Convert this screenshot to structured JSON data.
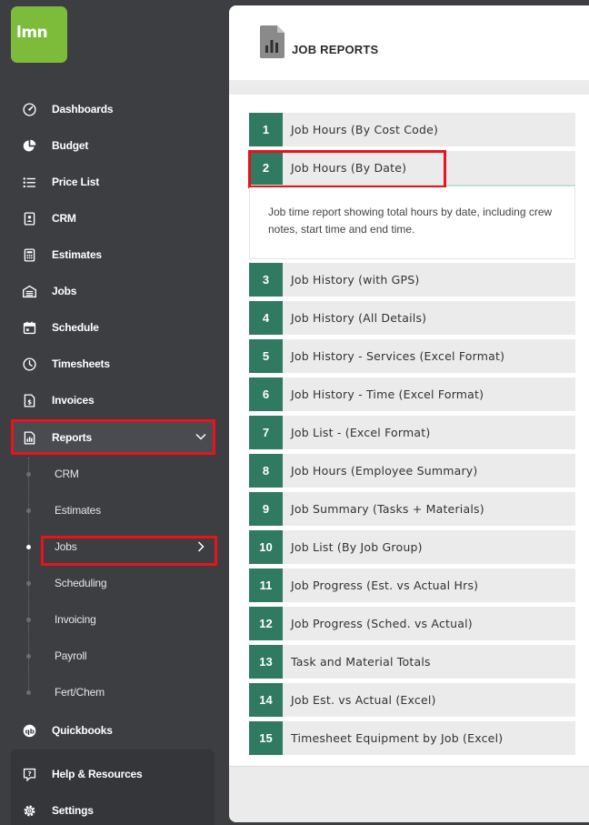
{
  "brand": {
    "logo_text": "lmn",
    "logo_color": "#7dbb3a"
  },
  "sidebar": {
    "items": [
      {
        "label": "Dashboards",
        "icon": "gauge-icon"
      },
      {
        "label": "Budget",
        "icon": "pie-chart-icon"
      },
      {
        "label": "Price List",
        "icon": "list-icon"
      },
      {
        "label": "CRM",
        "icon": "contact-card-icon"
      },
      {
        "label": "Estimates",
        "icon": "calculator-icon"
      },
      {
        "label": "Jobs",
        "icon": "garage-icon"
      },
      {
        "label": "Schedule",
        "icon": "calendar-icon"
      },
      {
        "label": "Timesheets",
        "icon": "clock-icon"
      },
      {
        "label": "Invoices",
        "icon": "invoice-icon"
      },
      {
        "label": "Reports",
        "icon": "report-icon",
        "expanded": true
      }
    ],
    "report_subitems": [
      {
        "label": "CRM"
      },
      {
        "label": "Estimates"
      },
      {
        "label": "Jobs",
        "active": true
      },
      {
        "label": "Scheduling"
      },
      {
        "label": "Invoicing"
      },
      {
        "label": "Payroll"
      },
      {
        "label": "Fert/Chem"
      }
    ],
    "bottom_items": [
      {
        "label": "Quickbooks",
        "icon": "quickbooks-icon"
      },
      {
        "label": "Help & Resources",
        "icon": "help-icon"
      },
      {
        "label": "Settings",
        "icon": "gear-icon"
      }
    ]
  },
  "header": {
    "title": "JOB REPORTS",
    "icon": "report-document-icon"
  },
  "reports": [
    {
      "num": "1",
      "title": "Job Hours (By Cost Code)"
    },
    {
      "num": "2",
      "title": "Job Hours (By Date)",
      "expanded": true,
      "description": "Job time report showing total hours by date, including crew notes, start time and end time."
    },
    {
      "num": "3",
      "title": "Job History (with GPS)"
    },
    {
      "num": "4",
      "title": "Job History (All Details)"
    },
    {
      "num": "5",
      "title": "Job History - Services (Excel Format)"
    },
    {
      "num": "6",
      "title": "Job History - Time (Excel Format)"
    },
    {
      "num": "7",
      "title": "Job List - (Excel Format)"
    },
    {
      "num": "8",
      "title": "Job Hours (Employee Summary)"
    },
    {
      "num": "9",
      "title": "Job Summary (Tasks + Materials)"
    },
    {
      "num": "10",
      "title": "Job List (By Job Group)"
    },
    {
      "num": "11",
      "title": "Job Progress (Est. vs Actual Hrs)"
    },
    {
      "num": "12",
      "title": "Job Progress (Sched. vs Actual)"
    },
    {
      "num": "13",
      "title": "Task and Material Totals"
    },
    {
      "num": "14",
      "title": "Job Est. vs Actual (Excel)"
    },
    {
      "num": "15",
      "title": "Timesheet Equipment by Job (Excel)"
    }
  ],
  "colors": {
    "accent": "#2f7a60",
    "highlight": "#e8131b",
    "sidebar": "#3d3e42"
  }
}
